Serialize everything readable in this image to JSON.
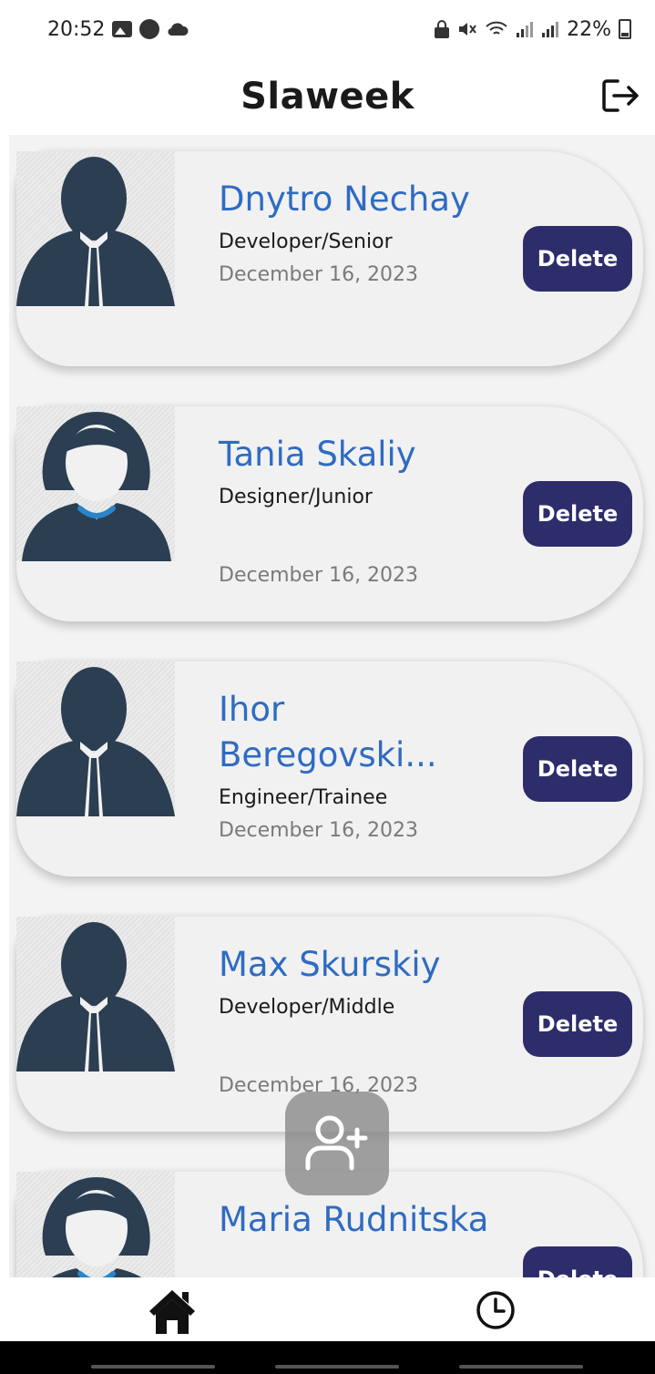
{
  "status_bar": {
    "time": "20:52",
    "battery": "22%",
    "icons_left": [
      "gallery-icon",
      "app-icon",
      "cloud-icon"
    ],
    "icons_right": [
      "lock-icon",
      "mute-icon",
      "wifi-icon",
      "signal-icon",
      "signal-icon",
      "battery-icon"
    ]
  },
  "header": {
    "title": "Slaweek",
    "logout_icon": "logout-icon"
  },
  "employees": [
    {
      "name": "Dnytro Nechay",
      "role": "Developer/Senior",
      "date": "December 16, 2023",
      "avatar": "male",
      "delete_label": "Delete"
    },
    {
      "name": "Tania Skaliy",
      "role": "Designer/Junior",
      "date": "December 16, 2023",
      "avatar": "female",
      "delete_label": "Delete"
    },
    {
      "name": "Ihor Beregovski...",
      "role": "Engineer/Trainee",
      "date": "December 16, 2023",
      "avatar": "male",
      "delete_label": "Delete"
    },
    {
      "name": "Max Skurskiy",
      "role": "Developer/Middle",
      "date": "December 16, 2023",
      "avatar": "male",
      "delete_label": "Delete"
    },
    {
      "name": "Maria Rudnitska",
      "role": "",
      "date": "",
      "avatar": "female",
      "delete_label": "Delete"
    }
  ],
  "fab": {
    "icon": "add-user-icon"
  },
  "bottom_nav": {
    "home_icon": "home-icon",
    "history_icon": "clock-icon"
  },
  "colors": {
    "accent_name": "#2f6bc2",
    "delete_button": "#2e2d6b",
    "avatar_dark": "#2b3e52",
    "collar_blue": "#2a84c8"
  }
}
